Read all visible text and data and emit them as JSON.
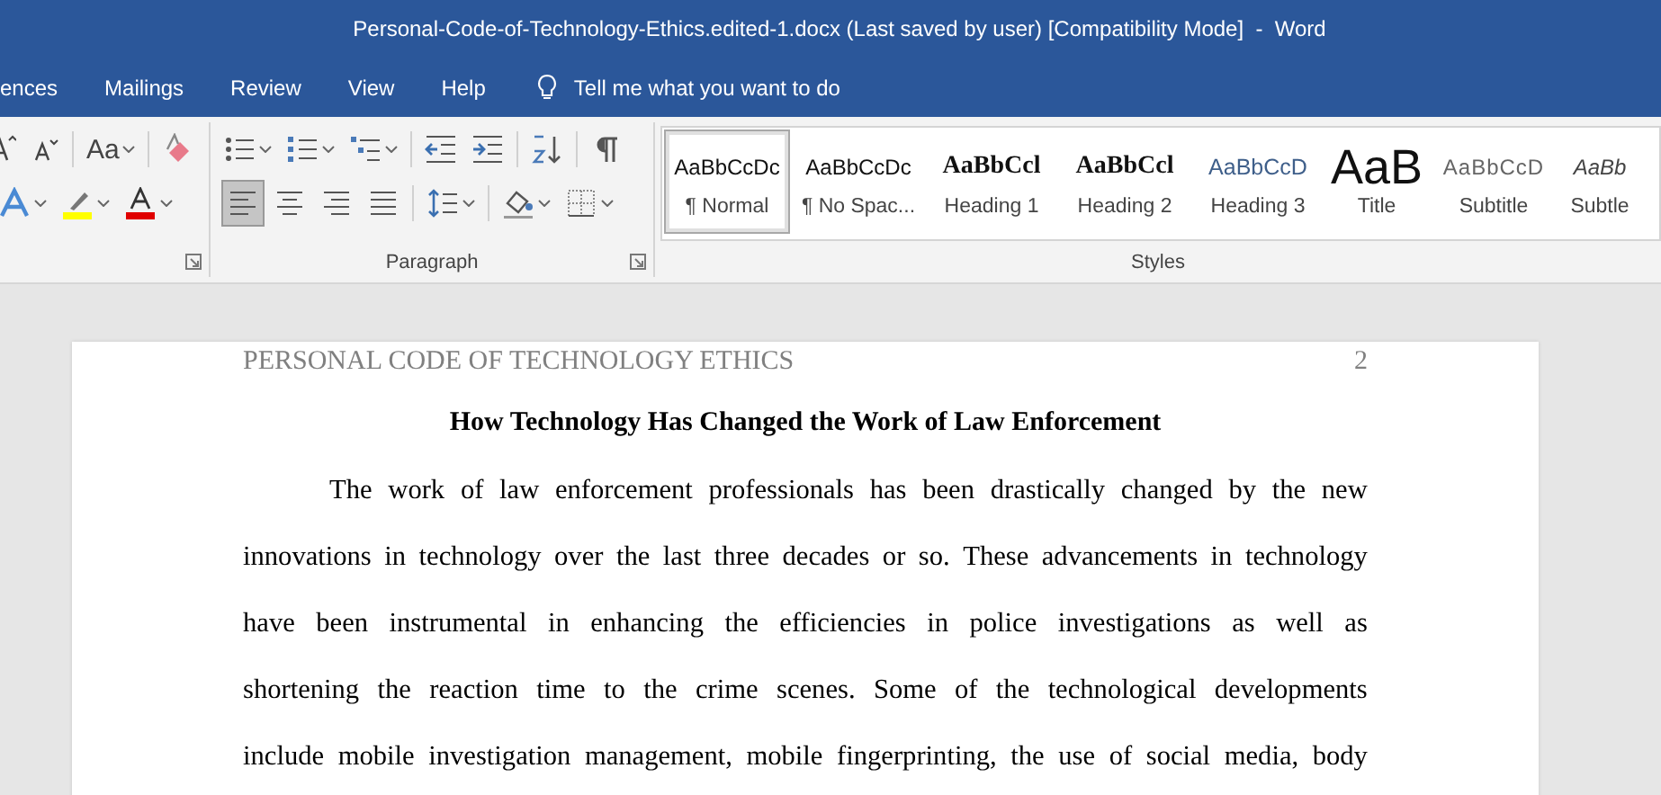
{
  "window": {
    "title": "Personal-Code-of-Technology-Ethics.edited-1.docx (Last saved by user) [Compatibility Mode]  -  Word"
  },
  "menu": {
    "tabs": [
      {
        "label": "ences"
      },
      {
        "label": "Mailings"
      },
      {
        "label": "Review"
      },
      {
        "label": "View"
      },
      {
        "label": "Help"
      }
    ],
    "tell_me": "Tell me what you want to do"
  },
  "font_group": {
    "change_case": "Aa"
  },
  "paragraph_group": {
    "label": "Paragraph",
    "alignments": [
      {
        "kind": "left",
        "selected": true
      },
      {
        "kind": "center",
        "selected": false
      },
      {
        "kind": "right",
        "selected": false
      },
      {
        "kind": "justify",
        "selected": false
      }
    ]
  },
  "styles": {
    "label": "Styles",
    "items": [
      {
        "kind": "plain",
        "preview": "AaBbCcDc",
        "label": "¶ Normal",
        "selected": true
      },
      {
        "kind": "plain",
        "preview": "AaBbCcDc",
        "label": "¶ No Spac...",
        "selected": false
      },
      {
        "kind": "heading",
        "preview": "AaBbCcl",
        "label": "Heading 1",
        "selected": false
      },
      {
        "kind": "heading",
        "preview": "AaBbCcl",
        "label": "Heading 2",
        "selected": false
      },
      {
        "kind": "accent",
        "preview": "AaBbCcD",
        "label": "Heading 3",
        "selected": false
      },
      {
        "kind": "title",
        "preview": "AaB",
        "label": "Title",
        "selected": false
      },
      {
        "kind": "muted",
        "preview": "AaBbCcD",
        "label": "Subtitle",
        "selected": false
      },
      {
        "kind": "italic",
        "preview": "AaBb",
        "label": "Subtle",
        "selected": false
      }
    ]
  },
  "document": {
    "header": "PERSONAL CODE OF TECHNOLOGY ETHICS",
    "page_number": "2",
    "heading": "How Technology Has Changed the Work of Law Enforcement",
    "lines": [
      "The work of law enforcement professionals has been drastically changed by the new",
      "innovations in technology over the last three decades or so. These advancements in technology",
      "have been instrumental in enhancing the efficiencies in police investigations as well as",
      "shortening the reaction time to the crime scenes. Some of the technological developments",
      "include mobile investigation management, mobile fingerprinting, the use of social media, body"
    ]
  }
}
